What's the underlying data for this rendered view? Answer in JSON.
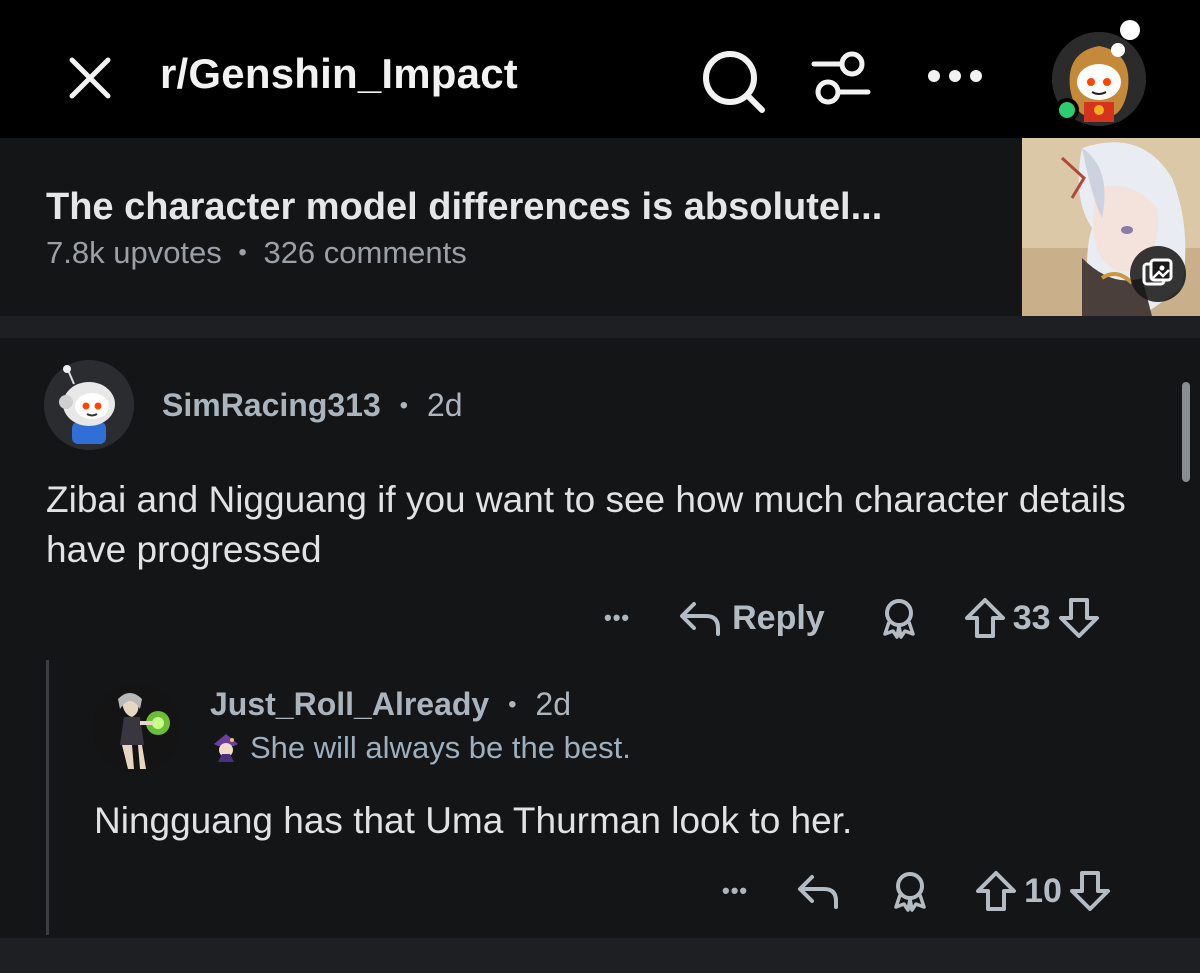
{
  "topbar": {
    "subreddit": "r/Genshin_Impact"
  },
  "post": {
    "title": "The character model differences is absolutel...",
    "upvotes": "7.8k upvotes",
    "separator": "•",
    "comments": "326 comments"
  },
  "comments": [
    {
      "username": "SimRacing313",
      "separator": "•",
      "age": "2d",
      "body": "Zibai and Nigguang if you want to see how much character details have progressed",
      "more": "•••",
      "reply_label": "Reply",
      "score": "33"
    },
    {
      "username": "Just_Roll_Already",
      "separator": "•",
      "age": "2d",
      "flair": "She will always be the best.",
      "body": "Ningguang has that Uma Thurman look to her.",
      "more": "•••",
      "score": "10"
    }
  ],
  "colors": {
    "background": "#0e0f11",
    "topbar": "#000000",
    "card": "#141517",
    "online": "#2ecc71",
    "text_muted": "#aeb6bd"
  }
}
